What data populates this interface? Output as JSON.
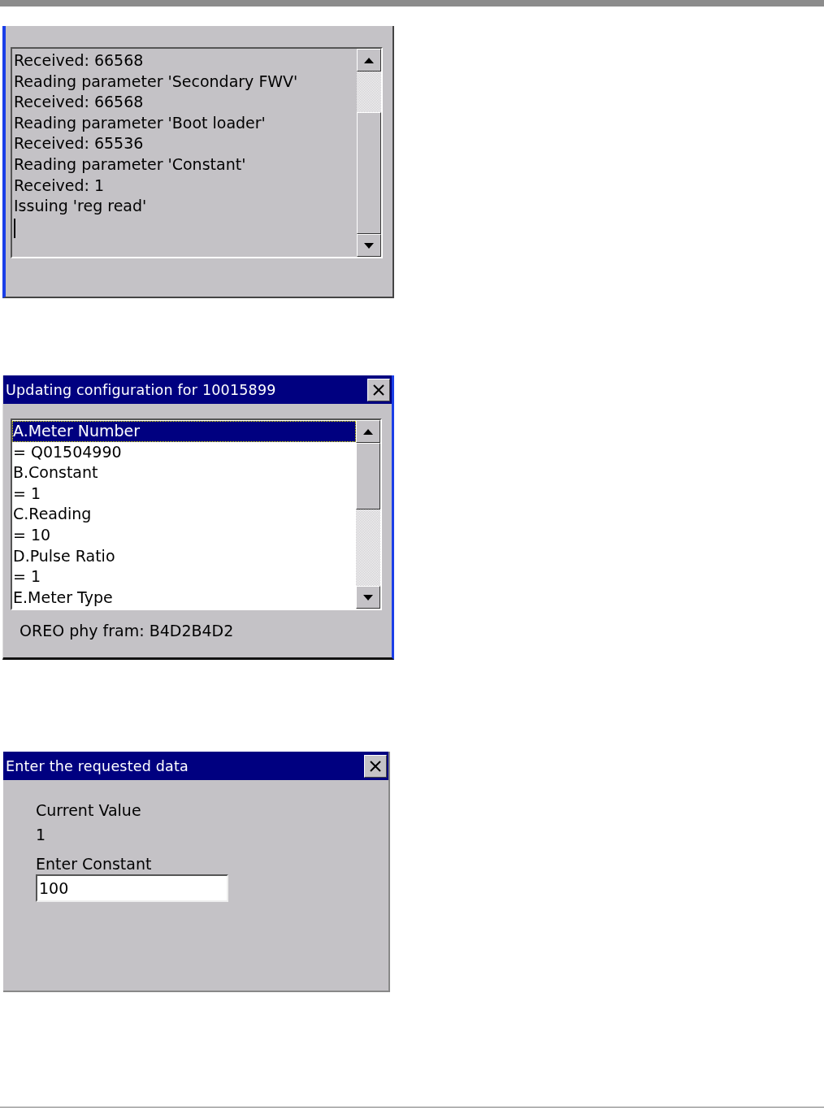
{
  "log_window": {
    "lines": [
      "Received: 66568",
      "Reading parameter 'Secondary FWV'",
      "Received: 66568",
      "Reading parameter 'Boot loader'",
      "Received: 65536",
      "Reading parameter 'Constant'",
      "Received: 1",
      "Issuing 'reg read'"
    ]
  },
  "config_window": {
    "title": "Updating configuration for 10015899",
    "items": [
      {
        "text": "A.Meter Number",
        "selected": true
      },
      {
        "text": "= Q01504990",
        "selected": false
      },
      {
        "text": "B.Constant",
        "selected": false
      },
      {
        "text": "= 1",
        "selected": false
      },
      {
        "text": "C.Reading",
        "selected": false
      },
      {
        "text": "= 10",
        "selected": false
      },
      {
        "text": "D.Pulse Ratio",
        "selected": false
      },
      {
        "text": "= 1",
        "selected": false
      },
      {
        "text": "E.Meter Type",
        "selected": false
      }
    ],
    "status": "OREO phy fram: B4D2B4D2"
  },
  "entry_window": {
    "title": "Enter the requested data",
    "current_label": "Current Value",
    "current_value": "1",
    "field_label": "Enter Constant",
    "field_value": "100"
  }
}
